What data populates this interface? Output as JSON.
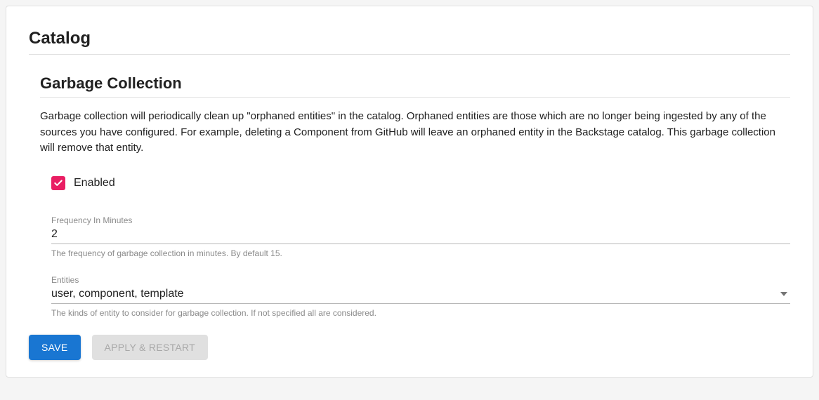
{
  "page": {
    "title": "Catalog"
  },
  "section": {
    "title": "Garbage Collection",
    "description": "Garbage collection will periodically clean up \"orphaned entities\" in the catalog. Orphaned entities are those which are no longer being ingested by any of the sources you have configured. For example, deleting a Component from GitHub will leave an orphaned entity in the Backstage catalog. This garbage collection will remove that entity."
  },
  "form": {
    "enabled": {
      "label": "Enabled",
      "checked": true
    },
    "frequency": {
      "label": "Frequency In Minutes",
      "value": "2",
      "helper": "The frequency of garbage collection in minutes. By default 15."
    },
    "entities": {
      "label": "Entities",
      "value": "user, component, template",
      "helper": "The kinds of entity to consider for garbage collection. If not specified all are considered."
    }
  },
  "actions": {
    "save": "Save",
    "apply_restart": "Apply & Restart"
  }
}
